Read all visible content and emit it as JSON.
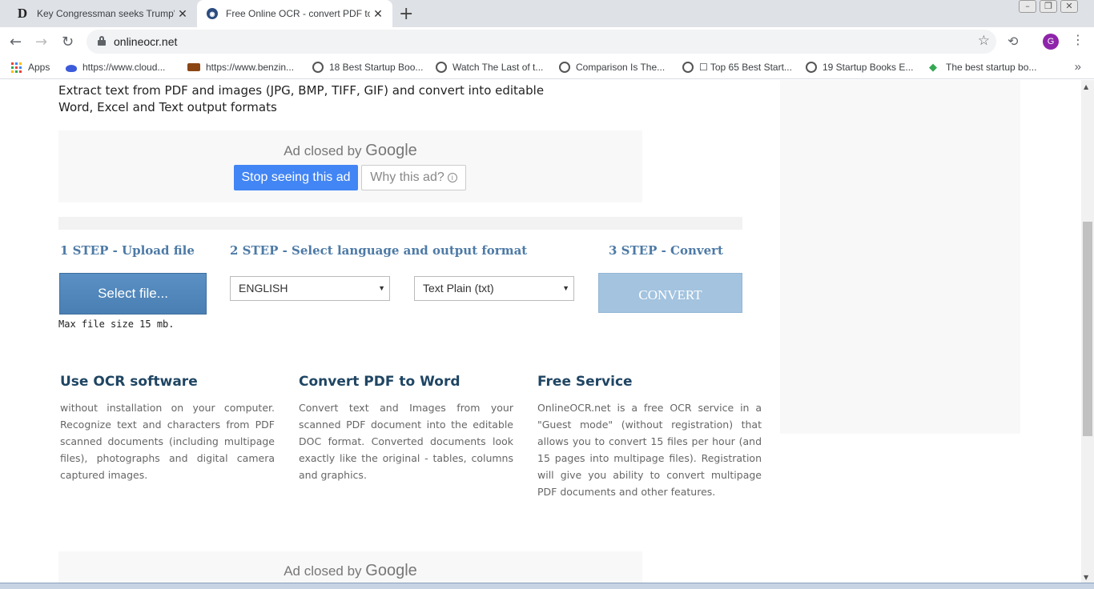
{
  "browser": {
    "tabs": [
      {
        "title": "Key Congressman seeks Trump's",
        "favicon": "D"
      },
      {
        "title": "Free Online OCR - convert PDF to",
        "favicon": "ocr-icon"
      }
    ],
    "new_tab": "+",
    "url": "onlineocr.net",
    "avatar_letter": "G",
    "bookmarks": [
      {
        "label": "Apps",
        "icon": "apps-grid-icon"
      },
      {
        "label": "https://www.cloud...",
        "icon": "cloud-icon"
      },
      {
        "label": "https://www.benzin...",
        "icon": "site-icon"
      },
      {
        "label": "18 Best Startup Boo...",
        "icon": "globe-icon"
      },
      {
        "label": "Watch The Last of t...",
        "icon": "globe-icon"
      },
      {
        "label": "Comparison Is The...",
        "icon": "globe-icon"
      },
      {
        "label": "☐ Top 65 Best Start...",
        "icon": "globe-icon"
      },
      {
        "label": "19 Startup Books E...",
        "icon": "globe-icon"
      },
      {
        "label": "The best startup bo...",
        "icon": "diamond-icon"
      }
    ]
  },
  "page": {
    "intro": "Extract text from PDF and images (JPG, BMP, TIFF, GIF) and convert into editable Word, Excel and Text output formats",
    "ad": {
      "closed_prefix": "Ad closed by",
      "closed_brand": "Google",
      "stop_label": "Stop seeing this ad",
      "why_label": "Why this ad?",
      "info_glyph": "i"
    },
    "steps": {
      "step1": "1 STEP - Upload file",
      "step2": "2 STEP - Select language and output format",
      "step3": "3 STEP - Convert"
    },
    "select_file_label": "Select file...",
    "max_size": "Max file size 15 mb.",
    "language": {
      "selected": "ENGLISH"
    },
    "format": {
      "selected": "Text Plain (txt)"
    },
    "convert_label": "CONVERT",
    "features": [
      {
        "title": "Use OCR software",
        "text": "without installation on your computer. Recognize text and characters from PDF scanned documents (including multipage files), photographs and digital camera captured images."
      },
      {
        "title": "Convert PDF to Word",
        "text": "Convert text and Images from your scanned PDF document into the editable DOC format. Converted documents look exactly like the original - tables, columns and graphics."
      },
      {
        "title": "Free Service",
        "text": "OnlineOCR.net is a free OCR service in a \"Guest mode\" (without registration) that allows you to convert 15 files per hour (and 15 pages into multipage files). Registration will give you ability to convert multipage PDF documents and other features."
      }
    ]
  },
  "colors": {
    "step_heading": "#4d7aa6",
    "select_button": "#4a7fb3",
    "convert_button": "#a3c3df",
    "ad_stop_button": "#4285f4"
  }
}
